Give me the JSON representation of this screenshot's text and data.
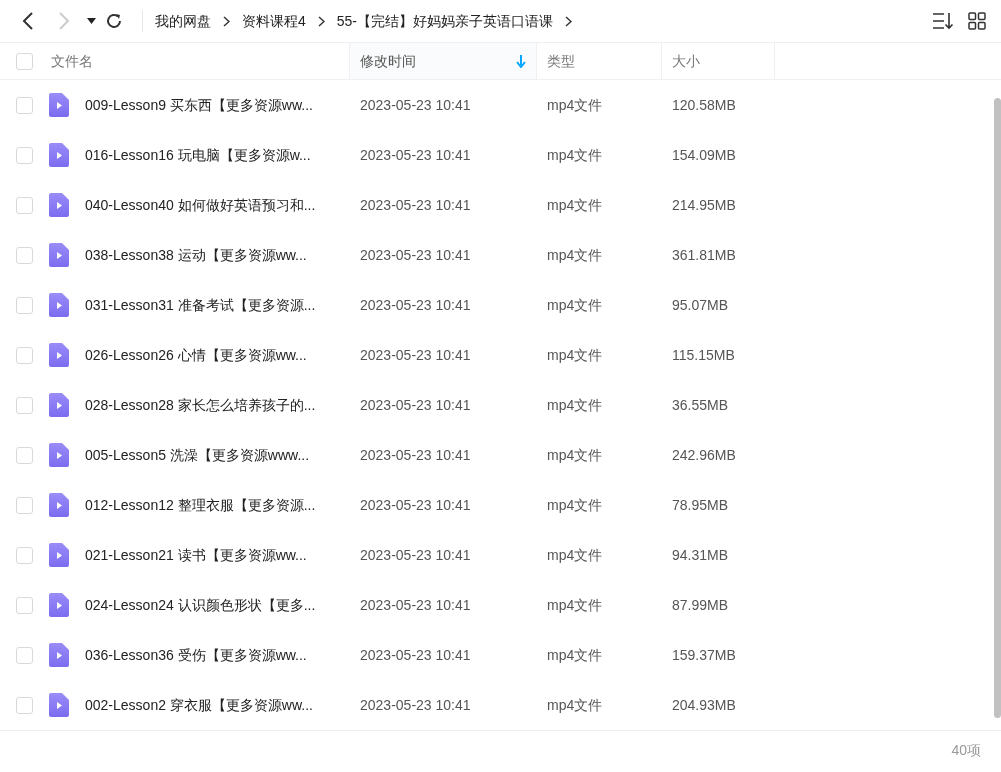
{
  "toolbar": {
    "back_disabled": false,
    "forward_disabled": true,
    "breadcrumbs": [
      "我的网盘",
      "资料课程4",
      "55-【完结】好妈妈亲子英语口语课"
    ]
  },
  "table": {
    "select_all_checked": false,
    "columns": [
      {
        "label": "文件名",
        "sorted": false
      },
      {
        "label": "修改时间",
        "sorted": true
      },
      {
        "label": "类型",
        "sorted": false
      },
      {
        "label": "大小",
        "sorted": false
      }
    ],
    "rows": [
      {
        "name": "009-Lesson9 买东西【更多资源ww...",
        "modified": "2023-05-23 10:41",
        "type": "mp4文件",
        "size": "120.58MB",
        "checked": false
      },
      {
        "name": "016-Lesson16 玩电脑【更多资源w...",
        "modified": "2023-05-23 10:41",
        "type": "mp4文件",
        "size": "154.09MB",
        "checked": false
      },
      {
        "name": "040-Lesson40 如何做好英语预习和...",
        "modified": "2023-05-23 10:41",
        "type": "mp4文件",
        "size": "214.95MB",
        "checked": false
      },
      {
        "name": "038-Lesson38 运动【更多资源ww...",
        "modified": "2023-05-23 10:41",
        "type": "mp4文件",
        "size": "361.81MB",
        "checked": false
      },
      {
        "name": "031-Lesson31 准备考试【更多资源...",
        "modified": "2023-05-23 10:41",
        "type": "mp4文件",
        "size": "95.07MB",
        "checked": false
      },
      {
        "name": "026-Lesson26 心情【更多资源ww...",
        "modified": "2023-05-23 10:41",
        "type": "mp4文件",
        "size": "115.15MB",
        "checked": false
      },
      {
        "name": "028-Lesson28 家长怎么培养孩子的...",
        "modified": "2023-05-23 10:41",
        "type": "mp4文件",
        "size": "36.55MB",
        "checked": false
      },
      {
        "name": "005-Lesson5 洗澡【更多资源www...",
        "modified": "2023-05-23 10:41",
        "type": "mp4文件",
        "size": "242.96MB",
        "checked": false
      },
      {
        "name": "012-Lesson12 整理衣服【更多资源...",
        "modified": "2023-05-23 10:41",
        "type": "mp4文件",
        "size": "78.95MB",
        "checked": false
      },
      {
        "name": "021-Lesson21 读书【更多资源ww...",
        "modified": "2023-05-23 10:41",
        "type": "mp4文件",
        "size": "94.31MB",
        "checked": false
      },
      {
        "name": "024-Lesson24 认识颜色形状【更多...",
        "modified": "2023-05-23 10:41",
        "type": "mp4文件",
        "size": "87.99MB",
        "checked": false
      },
      {
        "name": "036-Lesson36 受伤【更多资源ww...",
        "modified": "2023-05-23 10:41",
        "type": "mp4文件",
        "size": "159.37MB",
        "checked": false
      },
      {
        "name": "002-Lesson2 穿衣服【更多资源ww...",
        "modified": "2023-05-23 10:41",
        "type": "mp4文件",
        "size": "204.93MB",
        "checked": false
      }
    ]
  },
  "status_bar": {
    "count": "40项"
  }
}
